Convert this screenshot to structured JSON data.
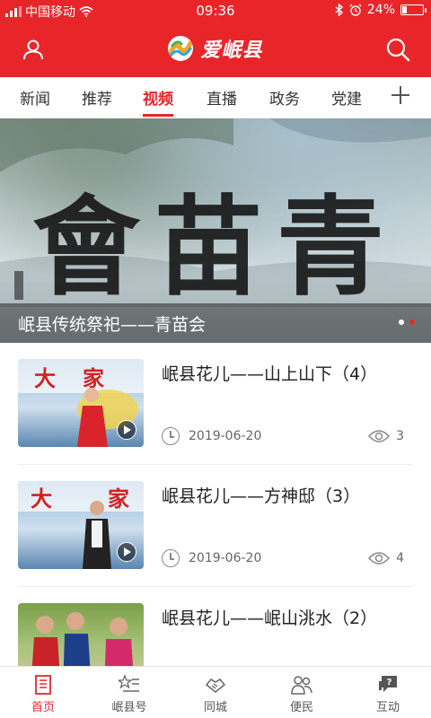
{
  "status_bar": {
    "carrier": "中国移动",
    "time": "09:36",
    "battery": "24%",
    "battery_level": 0.24
  },
  "header": {
    "logo_text": "爱岷县",
    "user_icon": "user-icon",
    "search_icon": "search-icon"
  },
  "tabs": [
    {
      "label": "新闻"
    },
    {
      "label": "推荐"
    },
    {
      "label": "视频",
      "active": true
    },
    {
      "label": "直播"
    },
    {
      "label": "政务"
    },
    {
      "label": "党建"
    }
  ],
  "banner": {
    "title": "岷县传统祭祀——青苗会",
    "art_text": "會苗青"
  },
  "videos": [
    {
      "title": "岷县花儿——山上山下（4）",
      "date": "2019-06-20",
      "views": "3"
    },
    {
      "title": "岷县花儿——方神邸（3）",
      "date": "2019-06-20",
      "views": "4"
    },
    {
      "title": "岷县花儿——岷山洮水（2）",
      "date": "",
      "views": ""
    }
  ],
  "bottom_nav": [
    {
      "label": "首页",
      "icon": "home-icon",
      "active": true
    },
    {
      "label": "岷县号",
      "icon": "star-list-icon"
    },
    {
      "label": "同城",
      "icon": "handshake-icon"
    },
    {
      "label": "便民",
      "icon": "people-icon"
    },
    {
      "label": "互动",
      "icon": "chat-question-icon"
    }
  ],
  "colors": {
    "brand_red": "#e8262a"
  }
}
